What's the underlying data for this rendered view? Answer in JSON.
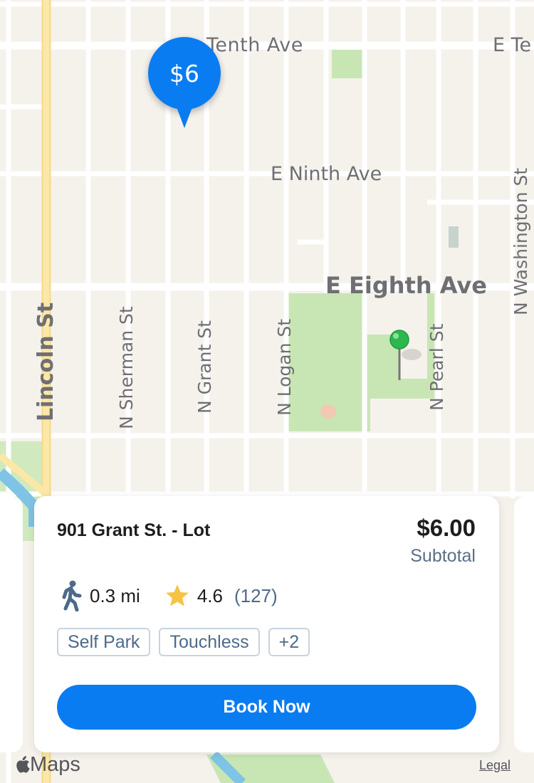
{
  "map": {
    "streets_horizontal": [
      "Tenth Ave",
      "E Te",
      "E Ninth Ave",
      "E Eighth Ave"
    ],
    "streets_vertical": [
      "Lincoln St",
      "N Sherman St",
      "N Grant St",
      "N Logan St",
      "N Pearl St",
      "N Washington St"
    ],
    "price_pin": "$6",
    "colors": {
      "background": "#f5f2ec",
      "park": "#c8e6b4",
      "road": "#ffffff",
      "arterial": "#fbe8a6",
      "accent": "#0a7cf2",
      "destination_pin": "#2db84e"
    }
  },
  "card": {
    "name": "901 Grant St. - Lot",
    "price": "$6.00",
    "price_label": "Subtotal",
    "distance": "0.3 mi",
    "rating": "4.6",
    "reviews": "(127)",
    "tags": [
      "Self Park",
      "Touchless",
      "+2"
    ],
    "cta": "Book Now"
  },
  "footer": {
    "logo_text": "Maps",
    "legal": "Legal"
  },
  "icons": {
    "walk": "walking-person-icon",
    "star": "star-icon",
    "apple": "apple-icon",
    "pin": "location-pin-icon"
  }
}
